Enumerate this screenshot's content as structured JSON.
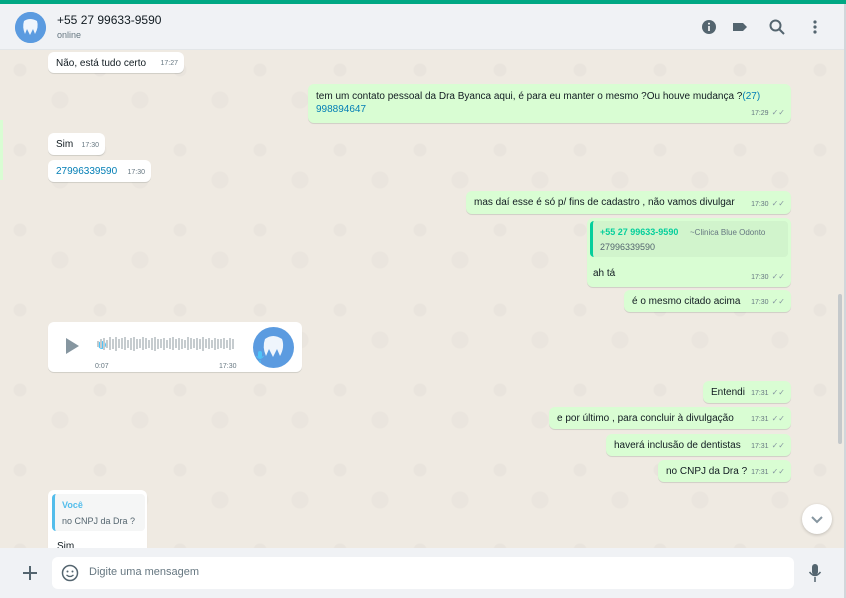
{
  "header": {
    "contact_name": "+55 27 99633-9590",
    "status": "online",
    "icons": [
      "info-icon",
      "label-icon",
      "search-icon",
      "menu-icon"
    ]
  },
  "messages": {
    "m1": {
      "text": "Não, está tudo certo",
      "time": "17:27"
    },
    "m2": {
      "text": "tem um contato pessoal da Dra Byanca aqui, é para eu manter o mesmo ?Ou houve mudança ?",
      "link": "(27) 998894647",
      "time": "17:29"
    },
    "m3": {
      "text": "Sim",
      "time": "17:30"
    },
    "m4": {
      "link": "27996339590",
      "time": "17:30"
    },
    "m5": {
      "text": "mas daí esse é só p/ fins de cadastro , não vamos divulgar",
      "time": "17:30"
    },
    "m6": {
      "quote_author": "+55 27 99633-9590",
      "quote_alias": "~Clinica Blue Odonto",
      "quote_text": "27996339590",
      "text": "ah tá",
      "time": "17:30"
    },
    "m7": {
      "text": "é o mesmo citado acima",
      "time": "17:30"
    },
    "m8": {
      "audio_duration": "0:07",
      "time": "17:30"
    },
    "m9": {
      "text": "Entendi",
      "time": "17:31"
    },
    "m10": {
      "text": "e por último , para concluir à divulgação",
      "time": "17:31"
    },
    "m11": {
      "text": "haverá inclusão de dentistas",
      "time": "17:31"
    },
    "m12": {
      "text": "no CNPJ da Dra ?",
      "time": "17:31"
    },
    "m13": {
      "quote_author": "Você",
      "quote_text": "no CNPJ da Dra ?",
      "text": "Sim"
    }
  },
  "composer": {
    "placeholder": "Digite uma mensagem"
  },
  "colors": {
    "outgoing": "#d9fdd3",
    "incoming": "#ffffff",
    "accent": "#00a884",
    "link": "#027eb5",
    "background": "#efeae2"
  }
}
